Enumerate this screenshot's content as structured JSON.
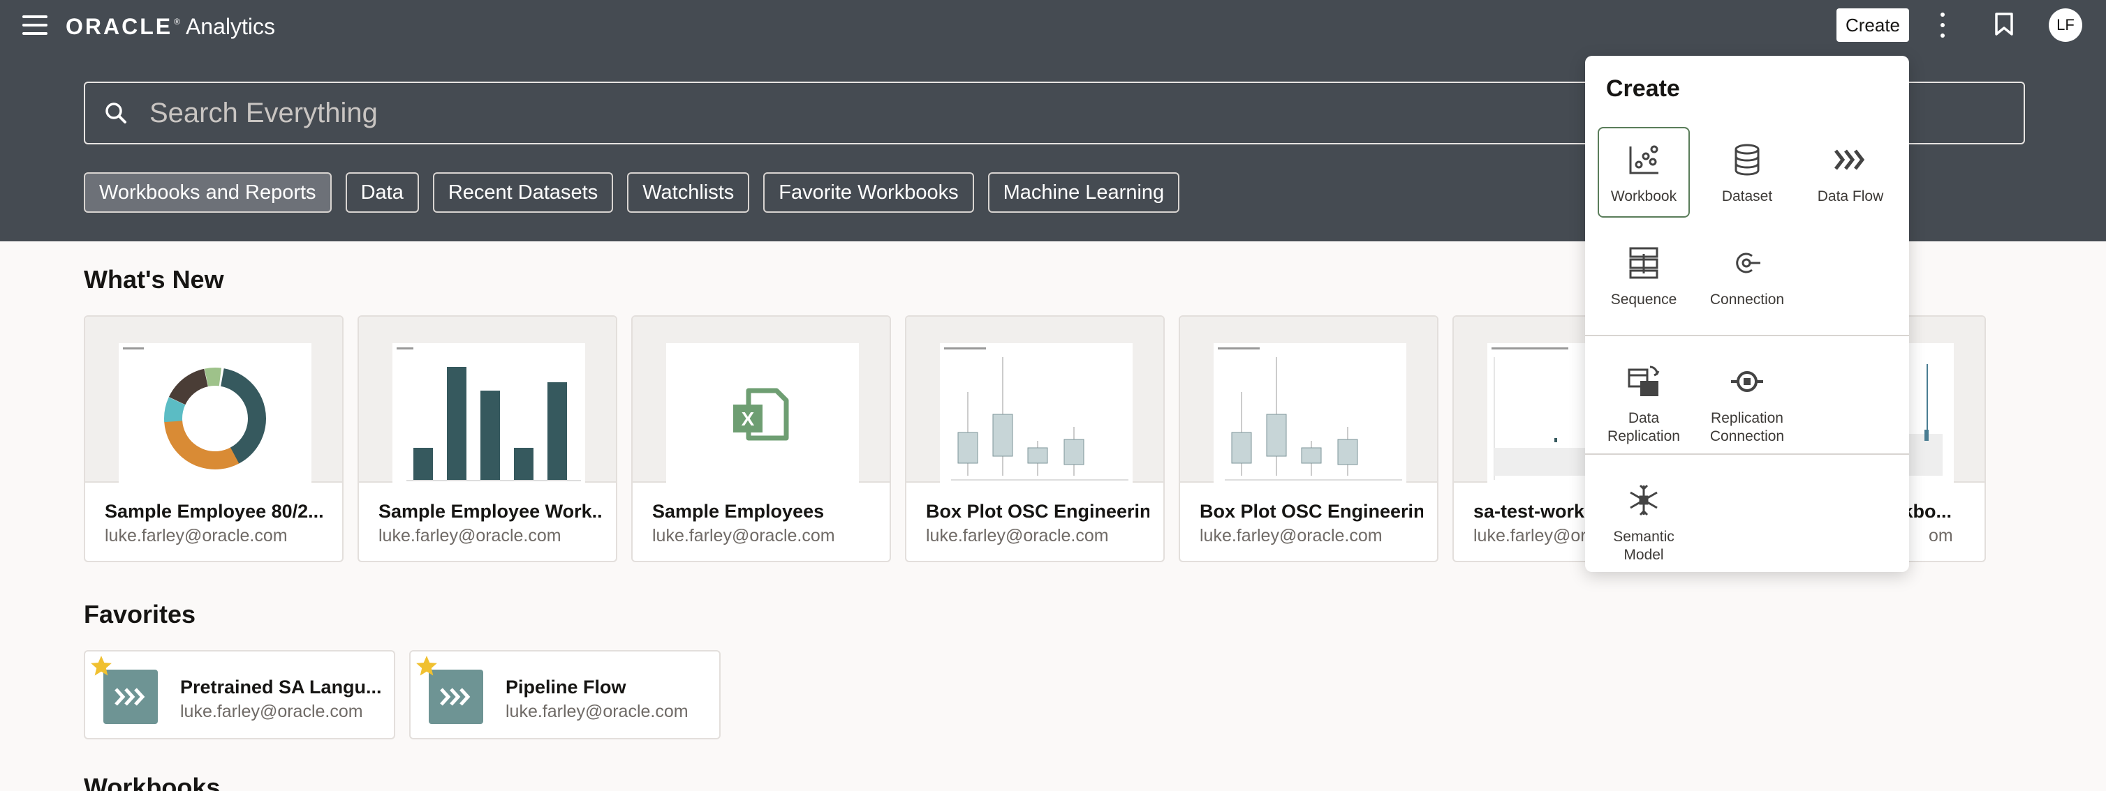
{
  "header": {
    "brand_oracle": "ORACLE",
    "brand_tm": "®",
    "brand_product": "Analytics",
    "create_label": "Create",
    "avatar_initials": "LF"
  },
  "search": {
    "placeholder": "Search Everything"
  },
  "chips": [
    "Workbooks and Reports",
    "Data",
    "Recent Datasets",
    "Watchlists",
    "Favorite Workbooks",
    "Machine Learning"
  ],
  "whats_new": {
    "title": "What's New",
    "cards": [
      {
        "name": "Sample Employee 80/2...",
        "email": "luke.farley@oracle.com",
        "thumb": "donut-chart"
      },
      {
        "name": "Sample Employee Work...",
        "email": "luke.farley@oracle.com",
        "thumb": "bar-chart"
      },
      {
        "name": "Sample Employees",
        "email": "luke.farley@oracle.com",
        "thumb": "excel-icon"
      },
      {
        "name": "Box Plot OSC Engineering",
        "email": "luke.farley@oracle.com",
        "thumb": "box-plot"
      },
      {
        "name": "Box Plot OSC Engineering",
        "email": "luke.farley@oracle.com",
        "thumb": "box-plot"
      },
      {
        "name": "sa-test-workb",
        "email": "luke.farley@or",
        "thumb": "scatter"
      },
      {
        "name": "rkbo...",
        "email": "om",
        "thumb": "spike"
      }
    ]
  },
  "favorites": {
    "title": "Favorites",
    "items": [
      {
        "name": "Pretrained SA Langu...",
        "email": "luke.farley@oracle.com"
      },
      {
        "name": "Pipeline Flow",
        "email": "luke.farley@oracle.com"
      }
    ]
  },
  "workbooks": {
    "title": "Workbooks"
  },
  "create_menu": {
    "title": "Create",
    "items": [
      {
        "label": "Workbook",
        "icon": "workbook-icon"
      },
      {
        "label": "Dataset",
        "icon": "dataset-icon"
      },
      {
        "label": "Data Flow",
        "icon": "data-flow-icon"
      },
      {
        "label": "Sequence",
        "icon": "sequence-icon"
      },
      {
        "label": "Connection",
        "icon": "connection-icon"
      },
      {
        "label": "Data\nReplication",
        "icon": "data-replication-icon"
      },
      {
        "label": "Replication\nConnection",
        "icon": "replication-connection-icon"
      },
      {
        "label": "Semantic\nModel",
        "icon": "semantic-model-icon"
      }
    ]
  },
  "colors": {
    "header_bg": "#454b52",
    "teal": "#36595e",
    "orange": "#d98b35",
    "accent_green": "#5a7d5a"
  }
}
